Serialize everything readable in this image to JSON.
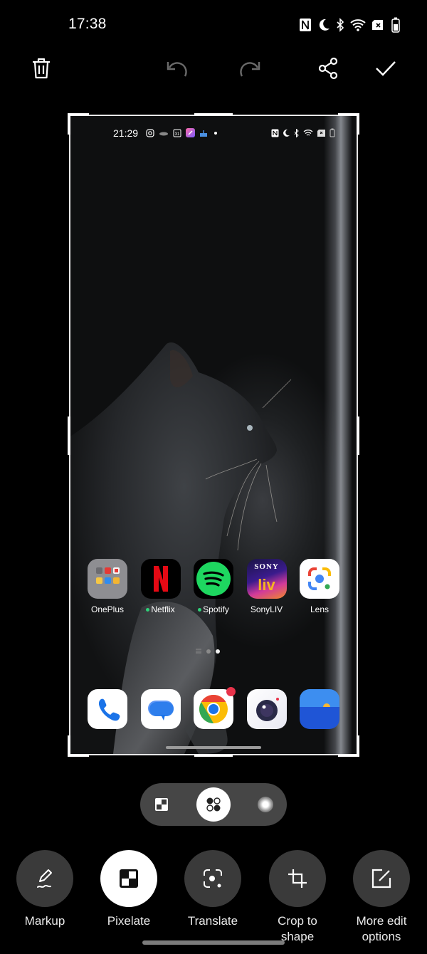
{
  "status_bar": {
    "time": "17:38",
    "icons": [
      "nfc-icon",
      "do-not-disturb-moon-icon",
      "bluetooth-icon",
      "wifi-icon",
      "no-sim-icon",
      "battery-icon"
    ]
  },
  "toolbar": {
    "delete": "delete-icon",
    "undo": "undo-icon",
    "redo": "redo-icon",
    "share": "share-icon",
    "done": "checkmark-icon"
  },
  "preview": {
    "status_bar": {
      "time": "21:29",
      "left_icons": [
        "instagram-icon",
        "cloud-icon",
        "calendar-31-icon",
        "app-notification-icon",
        "birthday-cake-icon",
        "more-dot-icon"
      ],
      "right_icons": [
        "nfc-icon",
        "moon-icon",
        "bluetooth-icon",
        "wifi-icon",
        "no-sim-icon",
        "battery-icon"
      ]
    },
    "apps": [
      {
        "label": "OnePlus",
        "icon": "folder-icon",
        "new": false
      },
      {
        "label": "Netflix",
        "icon": "netflix-icon",
        "new": true
      },
      {
        "label": "Spotify",
        "icon": "spotify-icon",
        "new": true
      },
      {
        "label": "SonyLIV",
        "icon": "sonyliv-icon",
        "new": false
      },
      {
        "label": "Lens",
        "icon": "google-lens-icon",
        "new": false
      }
    ],
    "sonyliv_brand": "SONY",
    "sonyliv_mark": "liv",
    "dock": [
      {
        "icon": "phone-icon"
      },
      {
        "icon": "messages-icon"
      },
      {
        "icon": "chrome-icon",
        "badge": true
      },
      {
        "icon": "camera-icon"
      },
      {
        "icon": "gallery-icon"
      }
    ],
    "page_indicator": {
      "pages": 2,
      "current": 2
    }
  },
  "pixelate_modes": [
    {
      "name": "square-pixels",
      "selected": false
    },
    {
      "name": "dot-pixels",
      "selected": true
    },
    {
      "name": "blur",
      "selected": false
    }
  ],
  "tools": [
    {
      "label": "Markup",
      "icon": "markup-pen-icon",
      "active": false
    },
    {
      "label": "Pixelate",
      "icon": "pixelate-icon",
      "active": true
    },
    {
      "label": "Translate",
      "icon": "translate-lens-icon",
      "active": false
    },
    {
      "label_line1": "Crop to",
      "label_line2": "shape",
      "icon": "crop-shape-icon",
      "active": false
    },
    {
      "label_line1": "More edit",
      "label_line2": "options",
      "icon": "edit-icon",
      "active": false
    }
  ],
  "colors": {
    "background": "#000000",
    "pill": "#464646",
    "tool_circle": "#3a3a3a",
    "active": "#ffffff",
    "netflix_red": "#e50914",
    "spotify_green": "#1ed760",
    "new_dot": "#2fd27a"
  }
}
